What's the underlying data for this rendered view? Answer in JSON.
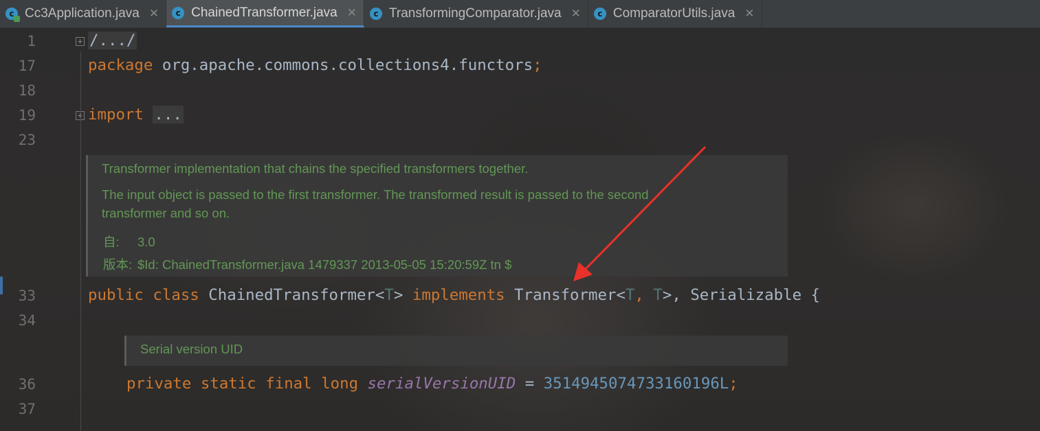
{
  "tabs": [
    {
      "label": "Cc3Application.java",
      "icon": "java-app-icon",
      "active": false
    },
    {
      "label": "ChainedTransformer.java",
      "icon": "java-class-icon",
      "active": true
    },
    {
      "label": "TransformingComparator.java",
      "icon": "java-class-icon",
      "active": false
    },
    {
      "label": "ComparatorUtils.java",
      "icon": "java-class-icon",
      "active": false
    }
  ],
  "tab_icon_letter": "c",
  "tab_close_glyph": "✕",
  "gutter": {
    "line_numbers": [
      "1",
      "17",
      "18",
      "19",
      "23",
      "33",
      "34",
      "36",
      "37"
    ],
    "fold_glyph": "+"
  },
  "code": {
    "line1_folded": "/.../",
    "line17": {
      "keyword": "package",
      "name": "org.apache.commons.collections4.functors",
      "semicolon": ";"
    },
    "line19": {
      "keyword": "import",
      "folded": "..."
    },
    "line33": {
      "public": "public",
      "class": "class",
      "name": "ChainedTransformer",
      "lt": "<",
      "T": "T",
      "gt": ">",
      "implements": "implements",
      "iface": "Transformer",
      "T2": "T",
      "comma": ",",
      "T3": "T",
      "rest": ">, Serializable {"
    },
    "line36": {
      "private": "private",
      "static": "static",
      "final": "final",
      "long": "long",
      "field": "serialVersionUID",
      "eq": " = ",
      "value": "3514945074733160196L",
      "semicolon": ";"
    }
  },
  "doc1": {
    "line1": "Transformer implementation that chains the specified transformers together.",
    "line2": "The input object is passed to the first transformer. The transformed result is passed to the second",
    "line3": "transformer and so on.",
    "since_label": "自:",
    "since_value": "3.0",
    "version_label": "版本:",
    "version_value": "$Id: ChainedTransformer.java 1479337 2013-05-05 15:20:59Z tn $"
  },
  "doc2": {
    "line1": "Serial version UID"
  },
  "colors": {
    "keyword": "#cc7832",
    "type_param": "#507874",
    "field": "#9876aa",
    "number": "#6897bb",
    "doc": "#629755",
    "arrow": "#e8312a"
  }
}
